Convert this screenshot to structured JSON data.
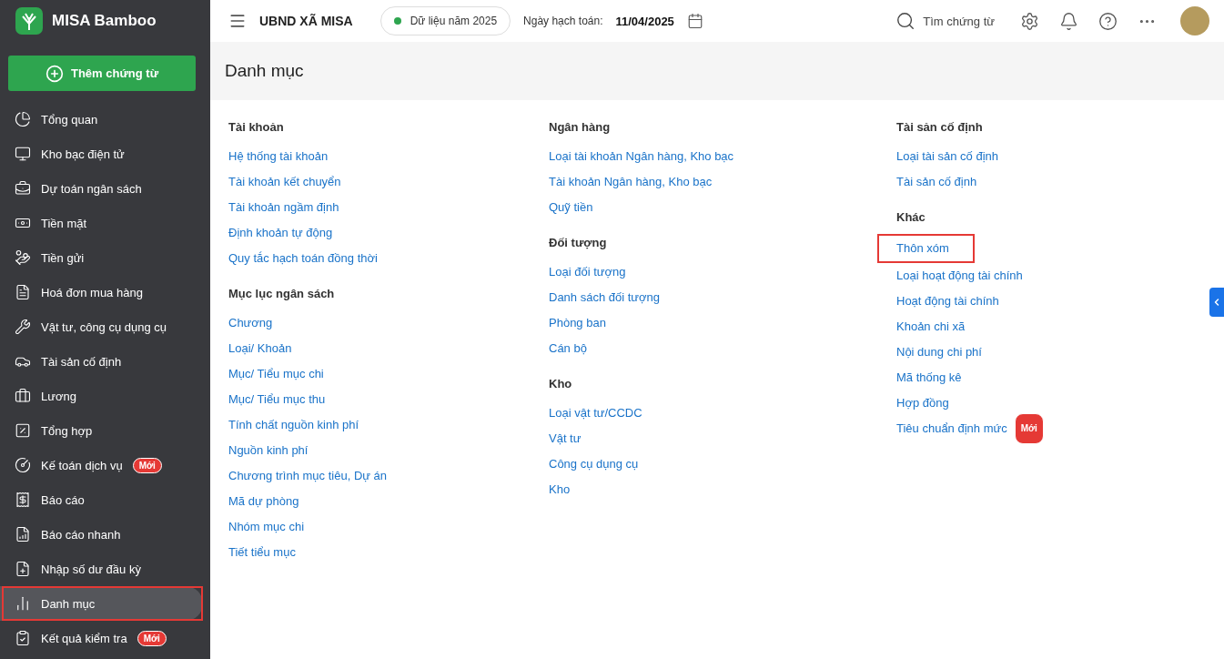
{
  "app": {
    "name": "MISA Bamboo"
  },
  "add_button": {
    "label": "Thêm chứng từ"
  },
  "sidebar": {
    "items": [
      {
        "label": "Tổng quan",
        "selected": false,
        "annotated": false
      },
      {
        "label": "Kho bạc điện tử",
        "selected": false,
        "annotated": false
      },
      {
        "label": "Dự toán ngân sách",
        "selected": false,
        "annotated": false
      },
      {
        "label": "Tiền mặt",
        "selected": false,
        "annotated": false
      },
      {
        "label": "Tiền gửi",
        "selected": false,
        "annotated": false
      },
      {
        "label": "Hoá đơn mua hàng",
        "selected": false,
        "annotated": false
      },
      {
        "label": "Vật tư, công cụ dụng cụ",
        "selected": false,
        "annotated": false
      },
      {
        "label": "Tài sản cố định",
        "selected": false,
        "annotated": false
      },
      {
        "label": "Lương",
        "selected": false,
        "annotated": false
      },
      {
        "label": "Tổng hợp",
        "selected": false,
        "annotated": false
      },
      {
        "label": "Kế toán dịch vụ",
        "badge": "Mới",
        "selected": false,
        "annotated": false
      },
      {
        "label": "Báo cáo",
        "selected": false,
        "annotated": false
      },
      {
        "label": "Báo cáo nhanh",
        "selected": false,
        "annotated": false
      },
      {
        "label": "Nhập số dư đầu kỳ",
        "selected": false,
        "annotated": false
      },
      {
        "label": "Danh mục",
        "selected": true,
        "annotated": true
      },
      {
        "label": "Kết quả kiểm tra",
        "badge": "Mới",
        "selected": false,
        "annotated": false
      }
    ]
  },
  "topbar": {
    "organization": "UBND XÃ MISA",
    "data_year": "Dữ liệu năm 2025",
    "posting_date_label": "Ngày hạch toán:",
    "posting_date": "11/04/2025",
    "search_label": "Tìm chứng từ"
  },
  "page": {
    "title": "Danh mục",
    "columns": [
      {
        "sections": [
          {
            "title": "Tài khoản",
            "links": [
              {
                "label": "Hệ thống tài khoản",
                "annotated": false
              },
              {
                "label": "Tài khoản kết chuyển",
                "annotated": false
              },
              {
                "label": "Tài khoản ngầm định",
                "annotated": false
              },
              {
                "label": "Định khoản tự động",
                "annotated": false
              },
              {
                "label": "Quy tắc hạch toán đồng thời",
                "annotated": false
              }
            ]
          },
          {
            "title": "Mục lục ngân sách",
            "links": [
              {
                "label": "Chương",
                "annotated": false
              },
              {
                "label": "Loại/ Khoản",
                "annotated": false
              },
              {
                "label": "Mục/ Tiểu mục chi",
                "annotated": false
              },
              {
                "label": "Mục/ Tiểu mục thu",
                "annotated": false
              },
              {
                "label": "Tính chất nguồn kinh phí",
                "annotated": false
              },
              {
                "label": "Nguồn kinh phí",
                "annotated": false
              },
              {
                "label": "Chương trình mục tiêu, Dự án",
                "annotated": false
              },
              {
                "label": "Mã dự phòng",
                "annotated": false
              },
              {
                "label": "Nhóm mục chi",
                "annotated": false
              },
              {
                "label": "Tiết tiểu mục",
                "annotated": false
              }
            ]
          }
        ]
      },
      {
        "sections": [
          {
            "title": "Ngân hàng",
            "links": [
              {
                "label": "Loại tài khoản Ngân hàng, Kho bạc",
                "annotated": false
              },
              {
                "label": "Tài khoản Ngân hàng, Kho bạc",
                "annotated": false
              },
              {
                "label": "Quỹ tiền",
                "annotated": false
              }
            ]
          },
          {
            "title": "Đối tượng",
            "links": [
              {
                "label": "Loại đối tượng",
                "annotated": false
              },
              {
                "label": "Danh sách đối tượng",
                "annotated": false
              },
              {
                "label": "Phòng ban",
                "annotated": false
              },
              {
                "label": "Cán bộ",
                "annotated": false
              }
            ]
          },
          {
            "title": "Kho",
            "links": [
              {
                "label": "Loại vật tư/CCDC",
                "annotated": false
              },
              {
                "label": "Vật tư",
                "annotated": false
              },
              {
                "label": "Công cụ dụng cụ",
                "annotated": false
              },
              {
                "label": "Kho",
                "annotated": false
              }
            ]
          }
        ]
      },
      {
        "sections": [
          {
            "title": "Tài sản cố định",
            "links": [
              {
                "label": "Loại tài sản cố định",
                "annotated": false
              },
              {
                "label": "Tài sản cố định",
                "annotated": false
              }
            ]
          },
          {
            "title": "Khác",
            "links": [
              {
                "label": "Thôn xóm",
                "annotated": true
              },
              {
                "label": "Loại hoạt động tài chính",
                "annotated": false
              },
              {
                "label": "Hoạt động tài chính",
                "annotated": false
              },
              {
                "label": "Khoản chi xã",
                "annotated": false
              },
              {
                "label": "Nội dung chi phí",
                "annotated": false
              },
              {
                "label": "Mã thống kê",
                "annotated": false
              },
              {
                "label": "Hợp đồng",
                "annotated": false
              },
              {
                "label": "Tiêu chuẩn định mức",
                "badge": "Mới",
                "annotated": false
              }
            ]
          }
        ]
      }
    ]
  }
}
